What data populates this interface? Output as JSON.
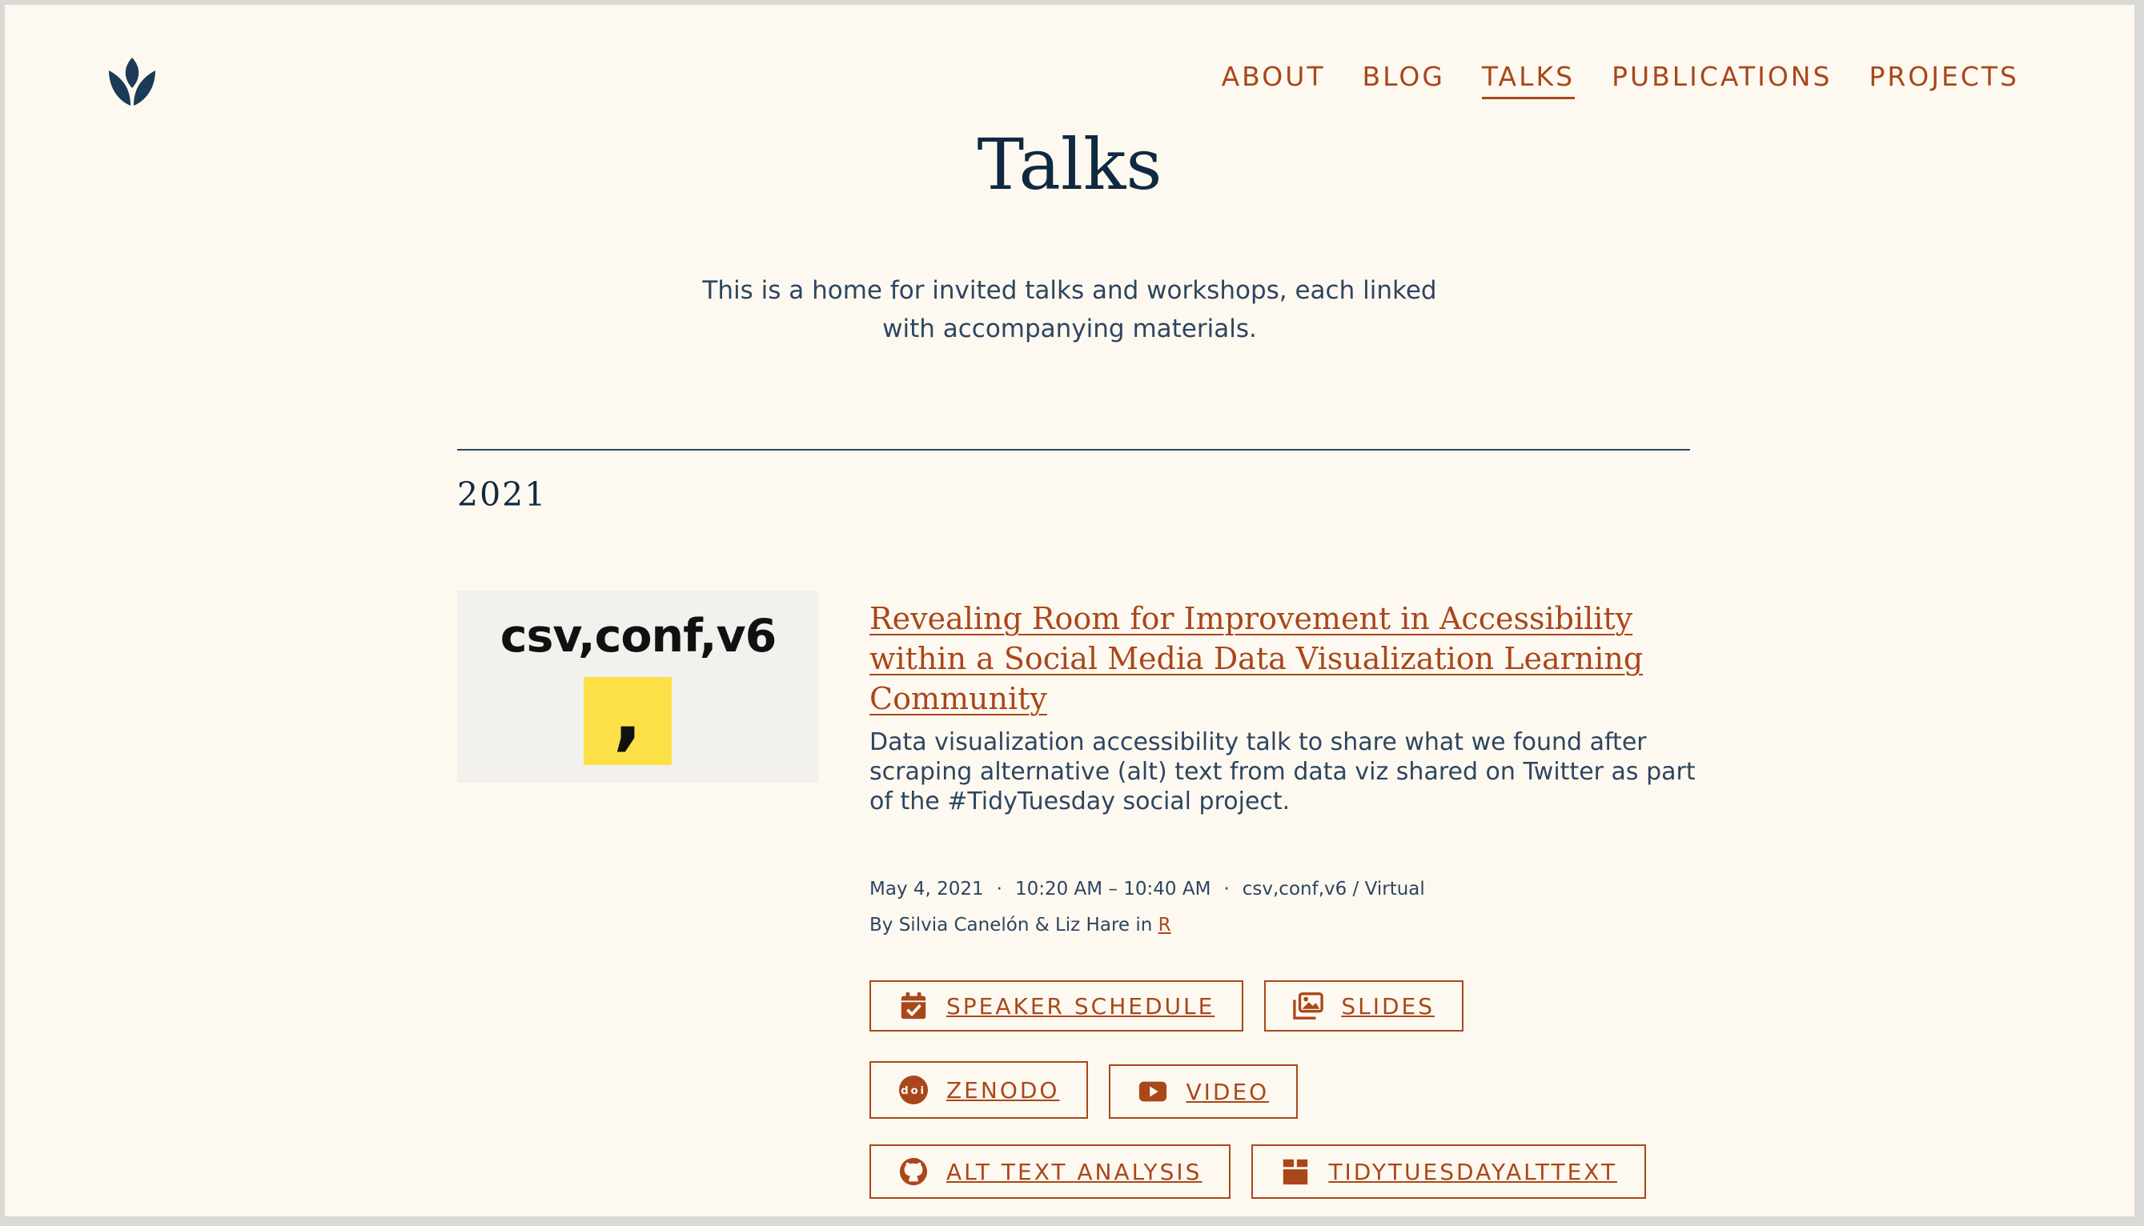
{
  "nav": {
    "logo_icon": "lotus-logo-icon",
    "items": [
      {
        "label": "ABOUT"
      },
      {
        "label": "BLOG"
      },
      {
        "label": "TALKS",
        "active": true
      },
      {
        "label": "PUBLICATIONS"
      },
      {
        "label": "PROJECTS"
      }
    ]
  },
  "page": {
    "title": "Talks",
    "intro_line1": "This is a home for invited talks and workshops, each linked",
    "intro_line2": "with accompanying materials."
  },
  "year": "2021",
  "talk": {
    "thumbnail": {
      "title": "csv,conf,v6",
      "mark": ","
    },
    "title": "Revealing Room for Improvement in Accessibility within a Social Media Data Visualization Learning Community",
    "description": "Data visualization accessibility talk to share what we found after scraping alternative (alt) text from data viz shared on Twitter as part of the #TidyTuesday social project.",
    "date": "May 4, 2021",
    "time": "10:20 AM – 10:40 AM",
    "venue": "csv,conf,v6 / Virtual",
    "separator": "·",
    "byline_prefix": "By Silvia Canelón & Liz Hare in ",
    "category": "R",
    "buttons": [
      {
        "label": "SPEAKER SCHEDULE",
        "icon": "calendar-check-icon"
      },
      {
        "label": "SLIDES",
        "icon": "images-icon"
      },
      {
        "label": "ZENODO",
        "icon": "doi-icon"
      },
      {
        "label": "VIDEO",
        "icon": "youtube-icon"
      },
      {
        "label": "ALT TEXT ANALYSIS",
        "icon": "github-icon"
      },
      {
        "label": "TIDYTUESDAYALTTEXT",
        "icon": "box-icon"
      }
    ]
  },
  "colors": {
    "background": "#fef9f0",
    "accent": "#a9471a",
    "heading": "#0f2940",
    "text": "#2d4560",
    "thumb_yellow": "#fde047"
  }
}
